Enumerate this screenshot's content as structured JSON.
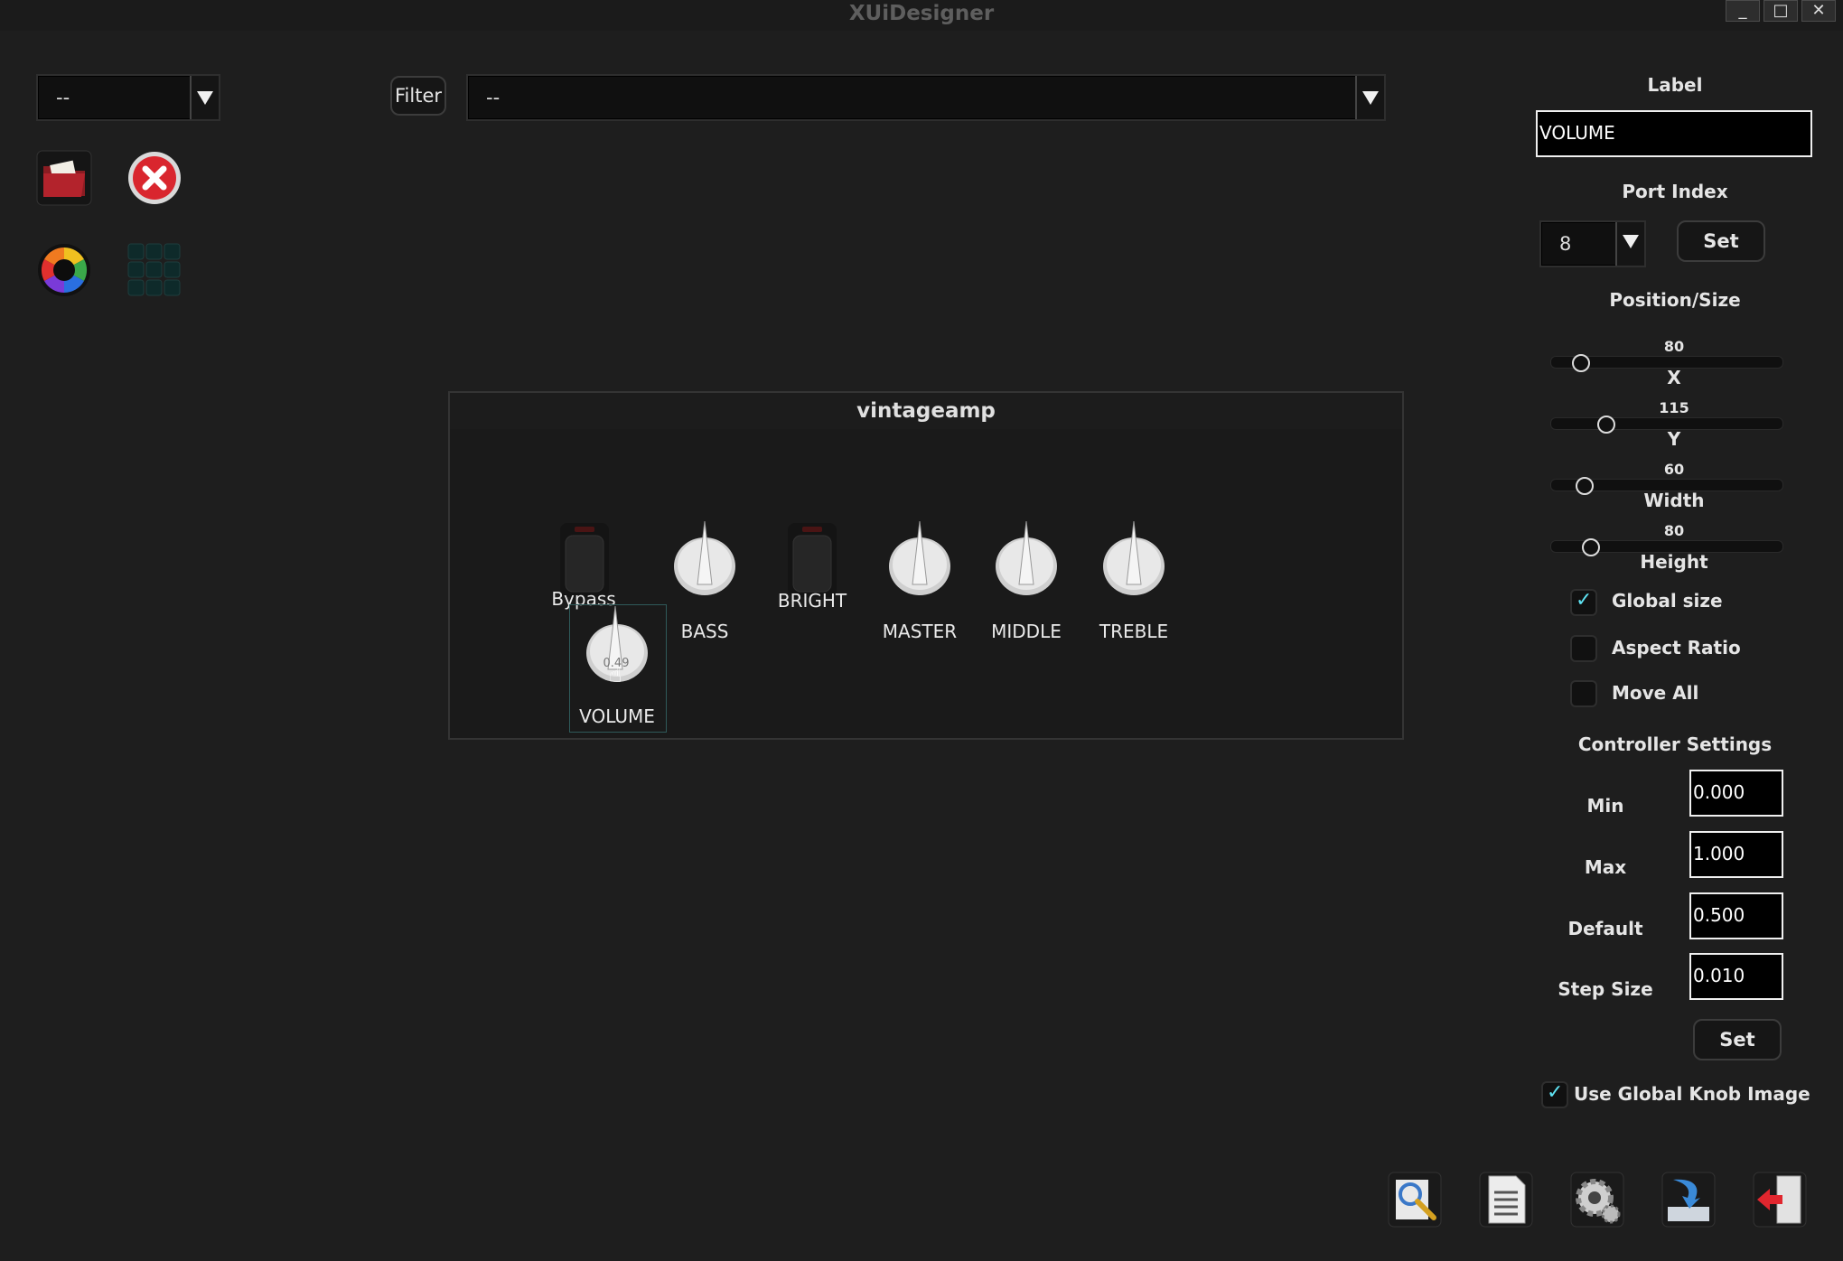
{
  "window": {
    "title": "XUiDesigner",
    "minimize": "_",
    "maximize": "□",
    "close": "✕"
  },
  "toolbar": {
    "left_combo_value": "--",
    "filter_label": "Filter",
    "filter_combo_value": "--"
  },
  "left_icons": [
    "open-folder-icon",
    "close-icon",
    "color-wheel-icon",
    "grid-icon"
  ],
  "plugin": {
    "title": "vintageamp",
    "controls": {
      "bypass": "Bypass",
      "bass": "BASS",
      "bright": "BRIGHT",
      "master": "MASTER",
      "middle": "MIDDLE",
      "treble": "TREBLE",
      "volume": "VOLUME",
      "volume_value": "0.49"
    }
  },
  "properties": {
    "label_heading": "Label",
    "label_value": "VOLUME",
    "port_heading": "Port Index",
    "port_value": "8",
    "port_set": "Set",
    "position_heading": "Position/Size",
    "sliders": [
      {
        "label": "X",
        "value": "80",
        "fraction": 0.1
      },
      {
        "label": "Y",
        "value": "115",
        "fraction": 0.22
      },
      {
        "label": "Width",
        "value": "60",
        "fraction": 0.12
      },
      {
        "label": "Height",
        "value": "80",
        "fraction": 0.15
      }
    ],
    "global_size": {
      "label": "Global size",
      "checked": true
    },
    "aspect_ratio": {
      "label": "Aspect Ratio",
      "checked": false
    },
    "move_all": {
      "label": "Move All",
      "checked": false
    },
    "controller_heading": "Controller Settings",
    "min_label": "Min",
    "min_value": "0.000",
    "max_label": "Max",
    "max_value": "1.000",
    "default_label": "Default",
    "default_value": "0.500",
    "step_label": "Step Size",
    "step_value": "0.010",
    "controller_set": "Set",
    "global_knob": {
      "label": "Use Global Knob Image",
      "checked": true
    }
  },
  "bottom_icons": [
    "edit-icon",
    "document-icon",
    "settings-icon",
    "save-icon",
    "exit-icon"
  ],
  "colors": {
    "background": "#1e1e1e",
    "accent_check": "#5fe4f4"
  }
}
